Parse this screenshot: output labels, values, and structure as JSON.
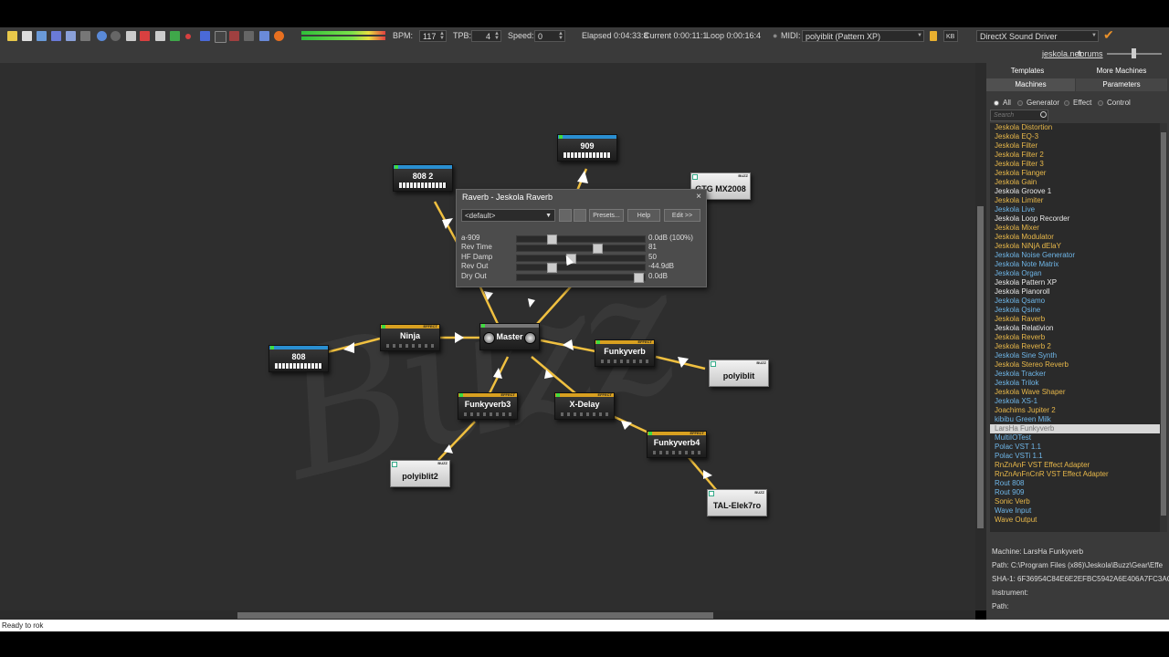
{
  "toolbar": {
    "bpm_label": "BPM:",
    "bpm_value": "117",
    "tpb_label": "TPB:",
    "tpb_value": "4",
    "speed_label": "Speed:",
    "speed_value": "0",
    "elapsed": "Elapsed 0:04:33:8",
    "current": "Current 0:00:11:1",
    "loop": "Loop 0:00:16:4",
    "midi_label": "MIDI:",
    "midi_value": "polyiblit (Pattern XP)",
    "kb_label": "KB",
    "driver_value": "DirectX Sound Driver",
    "site_link": "jeskola.net",
    "forums_link": "forums"
  },
  "machines": [
    {
      "id": "m909",
      "name": "909",
      "kind": "gen"
    },
    {
      "id": "m8082",
      "name": "808 2",
      "kind": "gen"
    },
    {
      "id": "m808",
      "name": "808",
      "kind": "gen"
    },
    {
      "id": "mgtg",
      "name": "GTG MX2008",
      "kind": "src",
      "tag": "BUZZ"
    },
    {
      "id": "mninja",
      "name": "Ninja",
      "kind": "eff",
      "tag": "EFFECT"
    },
    {
      "id": "mmaster",
      "name": "Master",
      "kind": "master"
    },
    {
      "id": "mfunky",
      "name": "Funkyverb",
      "kind": "eff",
      "tag": "EFFECT"
    },
    {
      "id": "mpoly",
      "name": "polyiblit",
      "kind": "src",
      "tag": "BUZZ"
    },
    {
      "id": "mfunky3",
      "name": "Funkyverb3",
      "kind": "eff",
      "tag": "EFFECT"
    },
    {
      "id": "mxdelay",
      "name": "X-Delay",
      "kind": "eff",
      "tag": "EFFECT"
    },
    {
      "id": "mfunky4",
      "name": "Funkyverb4",
      "kind": "eff",
      "tag": "EFFECT"
    },
    {
      "id": "mpoly2",
      "name": "polyiblit2",
      "kind": "src",
      "tag": "BUZZ"
    },
    {
      "id": "mtal",
      "name": "TAL-Elek7ro",
      "kind": "src",
      "tag": "BUZZ"
    }
  ],
  "dialog": {
    "title": "Raverb - Jeskola Raverb",
    "close": "×",
    "preset": "<default>",
    "presets_btn": "Presets...",
    "help_btn": "Help",
    "edit_btn": "Edit >>",
    "params": [
      {
        "label": "a-909",
        "value": "0.0dB (100%)",
        "level": 0.25
      },
      {
        "label": "Rev Time",
        "value": "81",
        "level": 0.63
      },
      {
        "label": "HF Damp",
        "value": "50",
        "level": 0.41
      },
      {
        "label": "Rev Out",
        "value": "-44.9dB",
        "level": 0.25
      },
      {
        "label": "Dry Out",
        "value": "0.0dB",
        "level": 0.98
      }
    ]
  },
  "panel": {
    "tabs": [
      "Templates",
      "More Machines",
      "Machines",
      "Parameters"
    ],
    "filters": [
      "All",
      "Generator",
      "Effect",
      "Control"
    ],
    "search_placeholder": "Search",
    "machines": [
      {
        "name": "Jeskola Distortion",
        "color": "#e8b84a"
      },
      {
        "name": "Jeskola EQ-3",
        "color": "#e8b84a"
      },
      {
        "name": "Jeskola Filter",
        "color": "#e8b84a"
      },
      {
        "name": "Jeskola Filter 2",
        "color": "#e8b84a"
      },
      {
        "name": "Jeskola Filter 3",
        "color": "#e8b84a"
      },
      {
        "name": "Jeskola Flanger",
        "color": "#e8b84a"
      },
      {
        "name": "Jeskola Gain",
        "color": "#e8b84a"
      },
      {
        "name": "Jeskola Groove 1",
        "color": "#e8e8e8"
      },
      {
        "name": "Jeskola Limiter",
        "color": "#e8b84a"
      },
      {
        "name": "Jeskola Live",
        "color": "#6fb6e8"
      },
      {
        "name": "Jeskola Loop Recorder",
        "color": "#e8e8e8"
      },
      {
        "name": "Jeskola Mixer",
        "color": "#e8b84a"
      },
      {
        "name": "Jeskola Modulator",
        "color": "#e8b84a"
      },
      {
        "name": "Jeskola NiNjA dElaY",
        "color": "#e8b84a"
      },
      {
        "name": "Jeskola Noise Generator",
        "color": "#6fb6e8"
      },
      {
        "name": "Jeskola Note Matrix",
        "color": "#6fb6e8"
      },
      {
        "name": "Jeskola Organ",
        "color": "#6fb6e8"
      },
      {
        "name": "Jeskola Pattern XP",
        "color": "#e8e8e8"
      },
      {
        "name": "Jeskola Pianoroll",
        "color": "#e8e8e8"
      },
      {
        "name": "Jeskola Qsamo",
        "color": "#6fb6e8"
      },
      {
        "name": "Jeskola Qsine",
        "color": "#6fb6e8"
      },
      {
        "name": "Jeskola Raverb",
        "color": "#e8b84a"
      },
      {
        "name": "Jeskola Relativion",
        "color": "#e8e8e8"
      },
      {
        "name": "Jeskola Reverb",
        "color": "#e8b84a"
      },
      {
        "name": "Jeskola Reverb 2",
        "color": "#e8b84a"
      },
      {
        "name": "Jeskola Sine Synth",
        "color": "#6fb6e8"
      },
      {
        "name": "Jeskola Stereo Reverb",
        "color": "#e8b84a"
      },
      {
        "name": "Jeskola Tracker",
        "color": "#6fb6e8"
      },
      {
        "name": "Jeskola Trilok",
        "color": "#6fb6e8"
      },
      {
        "name": "Jeskola Wave Shaper",
        "color": "#e8b84a"
      },
      {
        "name": "Jeskola XS-1",
        "color": "#6fb6e8"
      },
      {
        "name": "Joachims Jupiter 2",
        "color": "#e8b84a"
      },
      {
        "name": "kibibu Green Milk",
        "color": "#6fb6e8"
      },
      {
        "name": "LarsHa Funkyverb",
        "color": "#777777",
        "selected": true
      },
      {
        "name": "MultiIOTest",
        "color": "#6fb6e8"
      },
      {
        "name": "Polac VST 1.1",
        "color": "#6fb6e8"
      },
      {
        "name": "Polac VSTi 1.1",
        "color": "#6fb6e8"
      },
      {
        "name": "RnZnAnF VST Effect Adapter",
        "color": "#e8b84a"
      },
      {
        "name": "RnZnAnFnCnR VST Effect Adapter",
        "color": "#e8b84a"
      },
      {
        "name": "Rout 808",
        "color": "#6fb6e8"
      },
      {
        "name": "Rout 909",
        "color": "#6fb6e8"
      },
      {
        "name": "Sonic Verb",
        "color": "#e8b84a"
      },
      {
        "name": "Wave Input",
        "color": "#6fb6e8"
      },
      {
        "name": "Wave Output",
        "color": "#e8b84a"
      }
    ],
    "info_machine": "Machine:  LarsHa Funkyverb",
    "info_path": "Path:  C:\\Program Files (x86)\\Jeskola\\Buzz\\Gear\\Effe",
    "info_sha": "SHA-1:  6F36954C84E6E2EFBC5942A6E406A7FC3AC6",
    "info_instrument": "Instrument:",
    "info_path2": "Path:"
  },
  "status": "Ready to rok",
  "watermark": "Buzz",
  "colors": {
    "generator": "#2a8fd1",
    "effect": "#d8a020",
    "wire": "#f0c040"
  }
}
